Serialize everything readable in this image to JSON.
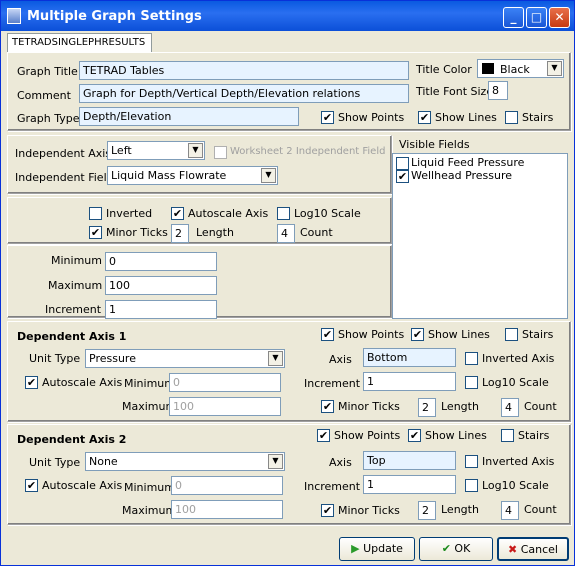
{
  "window": {
    "title": "Multiple Graph Settings",
    "min": "_",
    "max": "□",
    "close": "✕"
  },
  "tab": "TETRADSINGLEPHRESULTS",
  "graph": {
    "title_label": "Graph Title",
    "title_value": "TETRAD Tables",
    "comment_label": "Comment",
    "comment_value": "Graph for Depth/Vertical Depth/Elevation relations",
    "type_label": "Graph Type",
    "type_value": "Depth/Elevation",
    "title_color_label": "Title Color",
    "title_color_value": "Black",
    "title_color_hex": "#000000",
    "font_size_label": "Title Font Size",
    "font_size_value": "8",
    "show_points": "Show Points",
    "show_lines": "Show Lines",
    "stairs": "Stairs"
  },
  "indep": {
    "axis_label": "Independent Axis",
    "axis_value": "Left",
    "worksheet2": "Worksheet 2 Independent Field",
    "field_label": "Independent Field",
    "field_value": "Liquid Mass Flowrate",
    "inverted": "Inverted",
    "autoscale": "Autoscale Axis",
    "log10": "Log10 Scale",
    "minor_ticks": "Minor Ticks",
    "length_value": "2",
    "length_label": "Length",
    "count_value": "4",
    "count_label": "Count",
    "min_label": "Minimum",
    "min_value": "0",
    "max_label": "Maximum",
    "max_value": "100",
    "inc_label": "Increment",
    "inc_value": "1"
  },
  "visible": {
    "label": "Visible Fields",
    "items": [
      {
        "label": "Liquid Feed Pressure",
        "checked": false
      },
      {
        "label": "Wellhead Pressure",
        "checked": true
      }
    ]
  },
  "dep1": {
    "title": "Dependent Axis 1",
    "show_points": "Show Points",
    "show_lines": "Show Lines",
    "stairs": "Stairs",
    "unit_label": "Unit Type",
    "unit_value": "Pressure",
    "autoscale": "Autoscale Axis",
    "min_label": "Minimum",
    "min_value": "0",
    "max_label": "Maximum",
    "max_value": "100",
    "axis_label": "Axis",
    "axis_value": "Bottom",
    "inverted": "Inverted Axis",
    "inc_label": "Increment",
    "inc_value": "1",
    "log10": "Log10 Scale",
    "minor_ticks": "Minor Ticks",
    "length_value": "2",
    "length_label": "Length",
    "count_value": "4",
    "count_label": "Count"
  },
  "dep2": {
    "title": "Dependent Axis 2",
    "show_points": "Show Points",
    "show_lines": "Show Lines",
    "stairs": "Stairs",
    "unit_label": "Unit Type",
    "unit_value": "None",
    "autoscale": "Autoscale Axis",
    "min_label": "Minimum",
    "min_value": "0",
    "max_label": "Maximum",
    "max_value": "100",
    "axis_label": "Axis",
    "axis_value": "Top",
    "inverted": "Inverted Axis",
    "inc_label": "Increment",
    "inc_value": "1",
    "log10": "Log10 Scale",
    "minor_ticks": "Minor Ticks",
    "length_value": "2",
    "length_label": "Length",
    "count_value": "4",
    "count_label": "Count"
  },
  "buttons": {
    "update": "Update",
    "ok": "OK",
    "cancel": "Cancel"
  },
  "check": "✔"
}
